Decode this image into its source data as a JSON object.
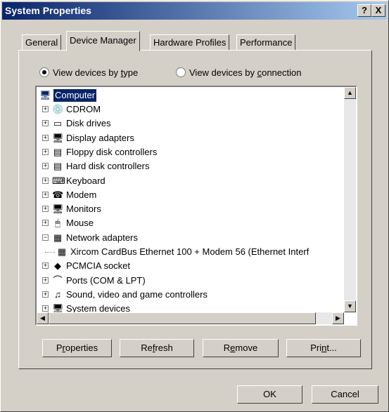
{
  "window": {
    "title": "System Properties",
    "help_label": "?",
    "close_label": "X"
  },
  "tabs": [
    "General",
    "Device Manager",
    "Hardware Profiles",
    "Performance"
  ],
  "view_options": [
    {
      "pre": "View devices by ",
      "key": "t",
      "post": "ype",
      "selected": true
    },
    {
      "pre": "View devices by ",
      "key": "c",
      "post": "onnection",
      "selected": false
    }
  ],
  "tree": {
    "root": "Computer",
    "items": [
      {
        "label": "CDROM",
        "icon": "cdrom-icon",
        "glyph": "💿",
        "expanded": false
      },
      {
        "label": "Disk drives",
        "icon": "disk-drive-icon",
        "glyph": "▭",
        "expanded": false
      },
      {
        "label": "Display adapters",
        "icon": "display-icon",
        "glyph": "🖥",
        "expanded": false
      },
      {
        "label": "Floppy disk controllers",
        "icon": "floppy-controller-icon",
        "glyph": "▤",
        "expanded": false
      },
      {
        "label": "Hard disk controllers",
        "icon": "hard-disk-controller-icon",
        "glyph": "▤",
        "expanded": false
      },
      {
        "label": "Keyboard",
        "icon": "keyboard-icon",
        "glyph": "⌨",
        "expanded": false
      },
      {
        "label": "Modem",
        "icon": "modem-icon",
        "glyph": "☎",
        "expanded": false
      },
      {
        "label": "Monitors",
        "icon": "monitor-icon",
        "glyph": "🖥",
        "expanded": false
      },
      {
        "label": "Mouse",
        "icon": "mouse-icon",
        "glyph": "🖱",
        "expanded": false
      },
      {
        "label": "Network adapters",
        "icon": "network-adapter-icon",
        "glyph": "▦",
        "expanded": true
      },
      {
        "label": "Xircom CardBus Ethernet 100 + Modem 56 (Ethernet Interf",
        "icon": "network-card-icon",
        "glyph": "▦",
        "child": true
      },
      {
        "label": "PCMCIA socket",
        "icon": "pcmcia-icon",
        "glyph": "◆",
        "expanded": false
      },
      {
        "label": "Ports (COM & LPT)",
        "icon": "port-icon",
        "glyph": "⌒",
        "expanded": false
      },
      {
        "label": "Sound, video and game controllers",
        "icon": "sound-icon",
        "glyph": "♫",
        "expanded": false
      },
      {
        "label": "System devices",
        "icon": "system-devices-icon",
        "glyph": "🖥",
        "expanded": false
      }
    ]
  },
  "buttons": {
    "properties": {
      "pre": "P",
      "key": "r",
      "post": "operties"
    },
    "refresh": {
      "pre": "Re",
      "key": "f",
      "post": "resh"
    },
    "remove": {
      "pre": "R",
      "key": "e",
      "post": "move"
    },
    "print": {
      "pre": "Pri",
      "key": "n",
      "post": "t..."
    },
    "ok": "OK",
    "cancel": "Cancel"
  },
  "colors": {
    "title_start": "#0a246a",
    "title_end": "#a6caf0",
    "selection": "#0a246a",
    "face": "#d4d0c8"
  }
}
